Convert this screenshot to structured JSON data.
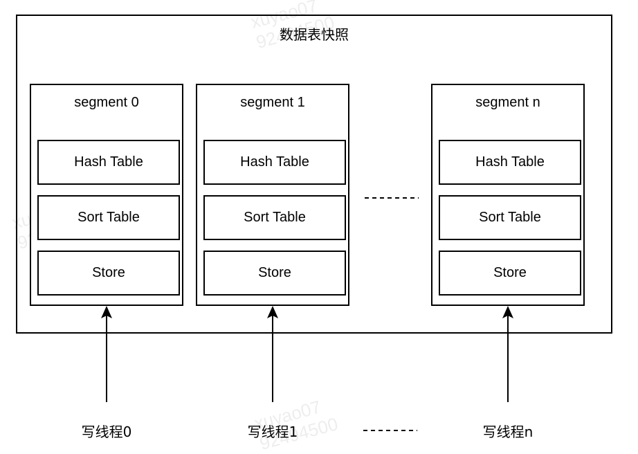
{
  "diagram": {
    "title": "数据表快照",
    "segments": [
      {
        "label": "segment 0",
        "items": [
          "Hash Table",
          "Sort Table",
          "Store"
        ]
      },
      {
        "label": "segment 1",
        "items": [
          "Hash Table",
          "Sort Table",
          "Store"
        ]
      },
      {
        "label": "segment n",
        "items": [
          "Hash Table",
          "Sort Table",
          "Store"
        ]
      }
    ],
    "segment_ellipsis": "-------",
    "threads": [
      {
        "label": "写线程0",
        "target": "segment 0"
      },
      {
        "label": "写线程1",
        "target": "segment 1"
      },
      {
        "label": "写线程n",
        "target": "segment n"
      }
    ],
    "thread_ellipsis": "-------",
    "watermark": {
      "line1": "xuyao07",
      "line2": "92494500"
    }
  }
}
